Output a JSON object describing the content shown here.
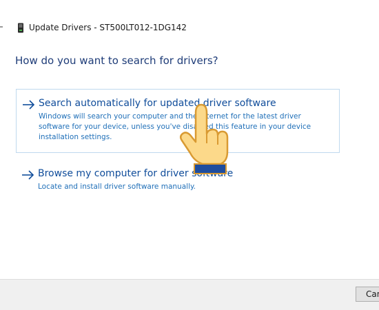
{
  "window": {
    "title": "Update Drivers - ST500LT012-1DG142",
    "icon": "device-icon"
  },
  "heading": "How do you want to search for drivers?",
  "options": [
    {
      "title": "Search automatically for updated driver software",
      "description": "Windows will search your computer and the Internet for the latest driver software for your device, unless you've disabled this feature in your device installation settings.",
      "icon": "arrow-right-icon"
    },
    {
      "title": "Browse my computer for driver software",
      "description": "Locate and install driver software manually.",
      "icon": "arrow-right-icon"
    }
  ],
  "footer": {
    "cancel_label": "Cancel"
  },
  "colors": {
    "heading": "#1e3c78",
    "option_title": "#0f4c9a",
    "option_desc": "#1f6fb8",
    "focus_border": "#bfd9ee",
    "footer_bg": "#f0f0f0"
  },
  "cursor": {
    "icon": "hand-pointer-icon"
  }
}
